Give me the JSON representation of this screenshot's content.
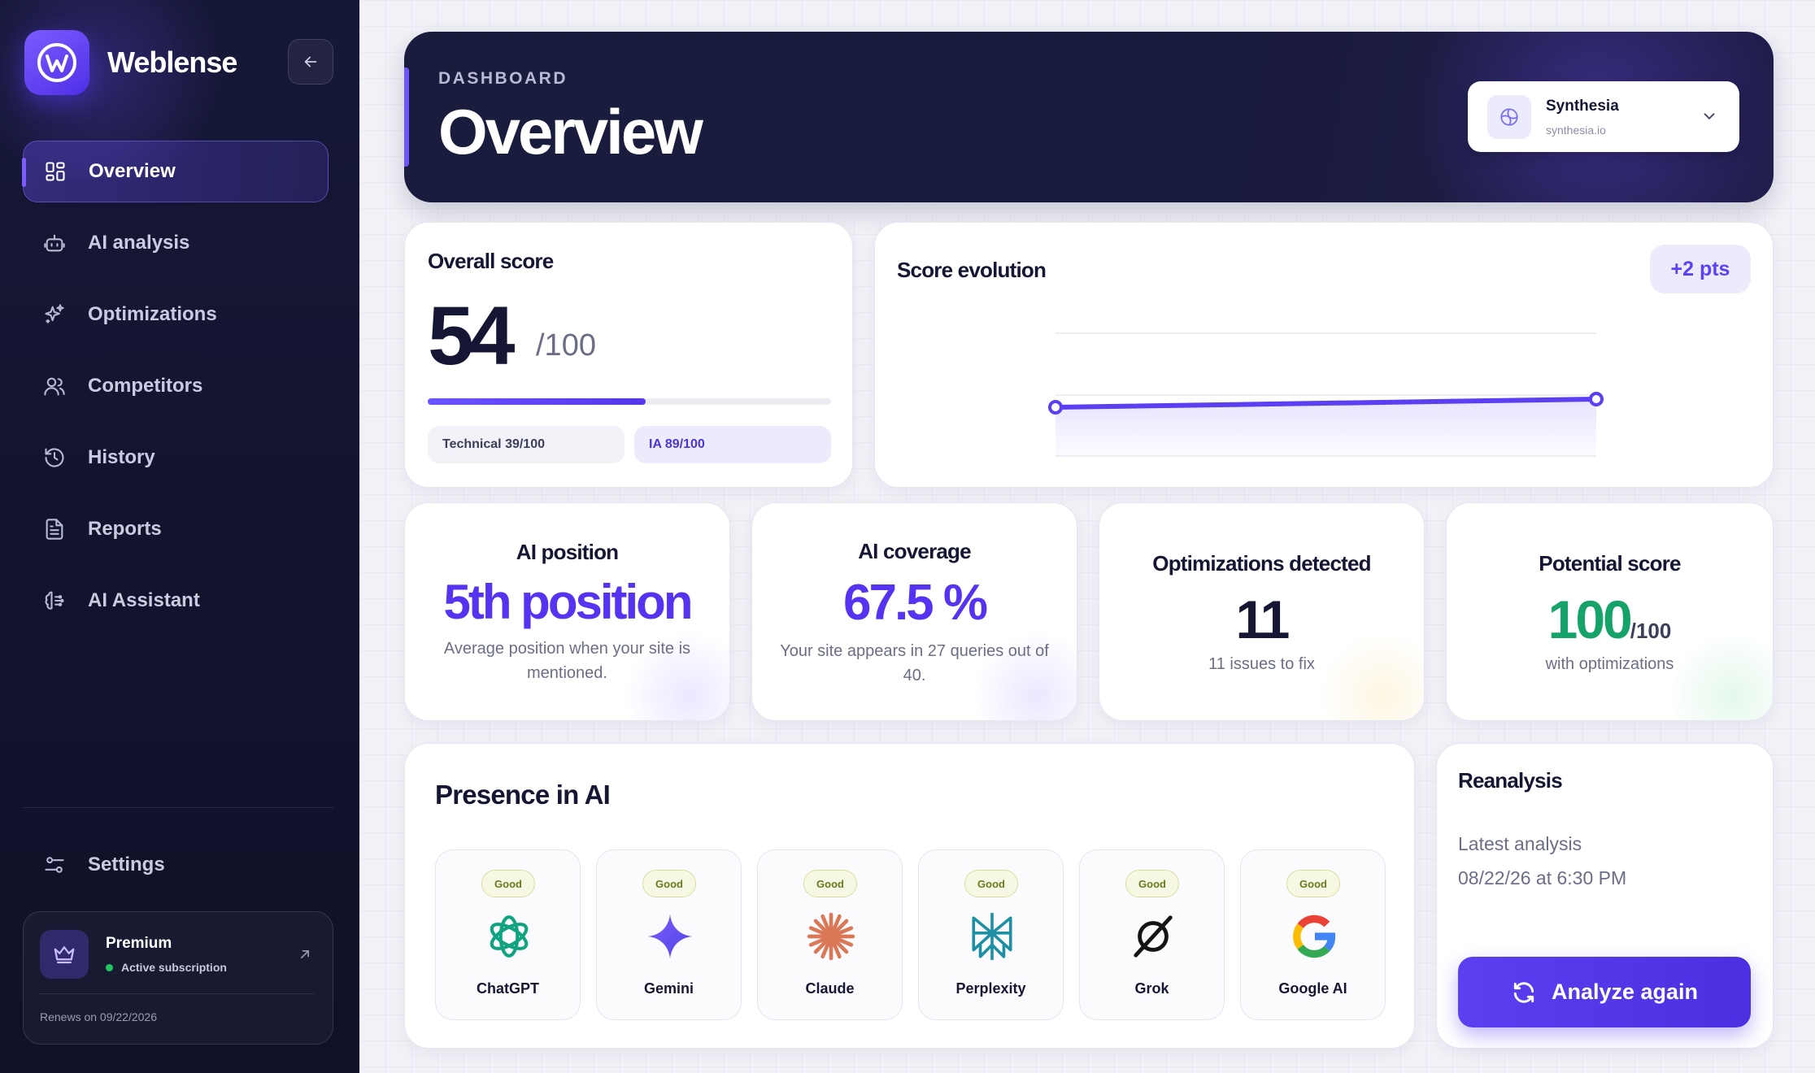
{
  "app": {
    "name": "Weblense"
  },
  "sidebar": {
    "items": [
      {
        "label": "Overview",
        "icon": "grid-icon"
      },
      {
        "label": "AI analysis",
        "icon": "robot-icon"
      },
      {
        "label": "Optimizations",
        "icon": "sparkles-icon"
      },
      {
        "label": "Competitors",
        "icon": "users-icon"
      },
      {
        "label": "History",
        "icon": "history-icon"
      },
      {
        "label": "Reports",
        "icon": "document-icon"
      },
      {
        "label": "AI Assistant",
        "icon": "brain-icon"
      }
    ],
    "active_index": 0,
    "settings_label": "Settings",
    "premium": {
      "title": "Premium",
      "status": "Active subscription",
      "renewal": "Renews on 09/22/2026"
    }
  },
  "header": {
    "eyebrow": "DASHBOARD",
    "title": "Overview",
    "site": {
      "name": "Synthesia",
      "domain": "synthesia.io"
    }
  },
  "overall_score": {
    "title": "Overall score",
    "value": "54",
    "denominator": "/100",
    "progress": 0.54,
    "technical": "Technical 39/100",
    "ia": "IA 89/100"
  },
  "score_evolution": {
    "title": "Score evolution",
    "delta": "+2 pts"
  },
  "chart_data": {
    "type": "line",
    "title": "Score evolution",
    "x": [
      "",
      ""
    ],
    "series": [
      {
        "values": [
          52,
          54
        ]
      }
    ],
    "ylim": [
      40,
      70
    ],
    "grid": true,
    "legend": "none"
  },
  "metrics": {
    "ai_position": {
      "title": "AI position",
      "value": "5th position",
      "desc": "Average position when your site is mentioned."
    },
    "ai_coverage": {
      "title": "AI coverage",
      "value": "67.5 %",
      "desc": "Your site appears in 27 queries out of 40."
    },
    "optimizations": {
      "title": "Optimizations detected",
      "value": "11",
      "desc": "11 issues to fix"
    },
    "potential": {
      "title": "Potential score",
      "value": "100",
      "denominator": "/100",
      "desc": "with optimizations"
    }
  },
  "presence": {
    "title": "Presence in AI",
    "items": [
      {
        "name": "ChatGPT",
        "status": "Good",
        "icon": "chatgpt-icon"
      },
      {
        "name": "Gemini",
        "status": "Good",
        "icon": "gemini-icon"
      },
      {
        "name": "Claude",
        "status": "Good",
        "icon": "claude-icon"
      },
      {
        "name": "Perplexity",
        "status": "Good",
        "icon": "perplexity-icon"
      },
      {
        "name": "Grok",
        "status": "Good",
        "icon": "grok-icon"
      },
      {
        "name": "Google AI",
        "status": "Good",
        "icon": "google-icon"
      }
    ]
  },
  "reanalysis": {
    "title": "Reanalysis",
    "latest_label": "Latest analysis",
    "latest_date": "08/22/26 at 6:30 PM",
    "button": "Analyze again"
  },
  "colors": {
    "accent": "#5b3ff0",
    "sidebar_bg": "#131533",
    "potential_green": "#16a36a",
    "good_badge": "#f7f8e4"
  }
}
